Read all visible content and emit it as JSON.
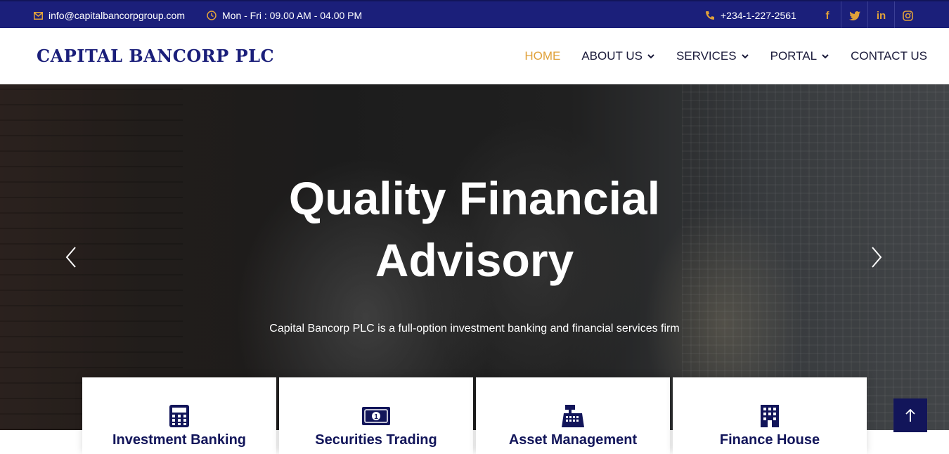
{
  "topbar": {
    "email": "info@capitalbancorpgroup.com",
    "hours": "Mon - Fri : 09.00 AM - 04.00 PM",
    "phone": "+234-1-227-2561",
    "social": [
      "facebook-icon",
      "twitter-icon",
      "linkedin-icon",
      "instagram-icon"
    ],
    "social_glyphs": {
      "facebook": "f",
      "linkedin": "in"
    }
  },
  "brand": {
    "name": "CAPITAL BANCORP PLC"
  },
  "nav": {
    "items": [
      {
        "label": "HOME",
        "active": true,
        "dropdown": false
      },
      {
        "label": "ABOUT US",
        "dropdown": true
      },
      {
        "label": "SERVICES",
        "dropdown": true
      },
      {
        "label": "PORTAL",
        "dropdown": true
      },
      {
        "label": "CONTACT US",
        "dropdown": false
      }
    ]
  },
  "hero": {
    "title_line1": "Quality Financial",
    "title_line2": "Advisory",
    "subtitle": "Capital Bancorp PLC is a full-option investment banking and financial services firm"
  },
  "services": [
    {
      "title": "Investment Banking",
      "icon": "calculator-icon"
    },
    {
      "title": "Securities Trading",
      "icon": "money-bill-icon"
    },
    {
      "title": "Asset Management",
      "icon": "cash-register-icon"
    },
    {
      "title": "Finance House",
      "icon": "building-icon"
    }
  ],
  "colors": {
    "primary": "#1b1f7a",
    "accent": "#e0a13a",
    "dark": "#12155a"
  }
}
